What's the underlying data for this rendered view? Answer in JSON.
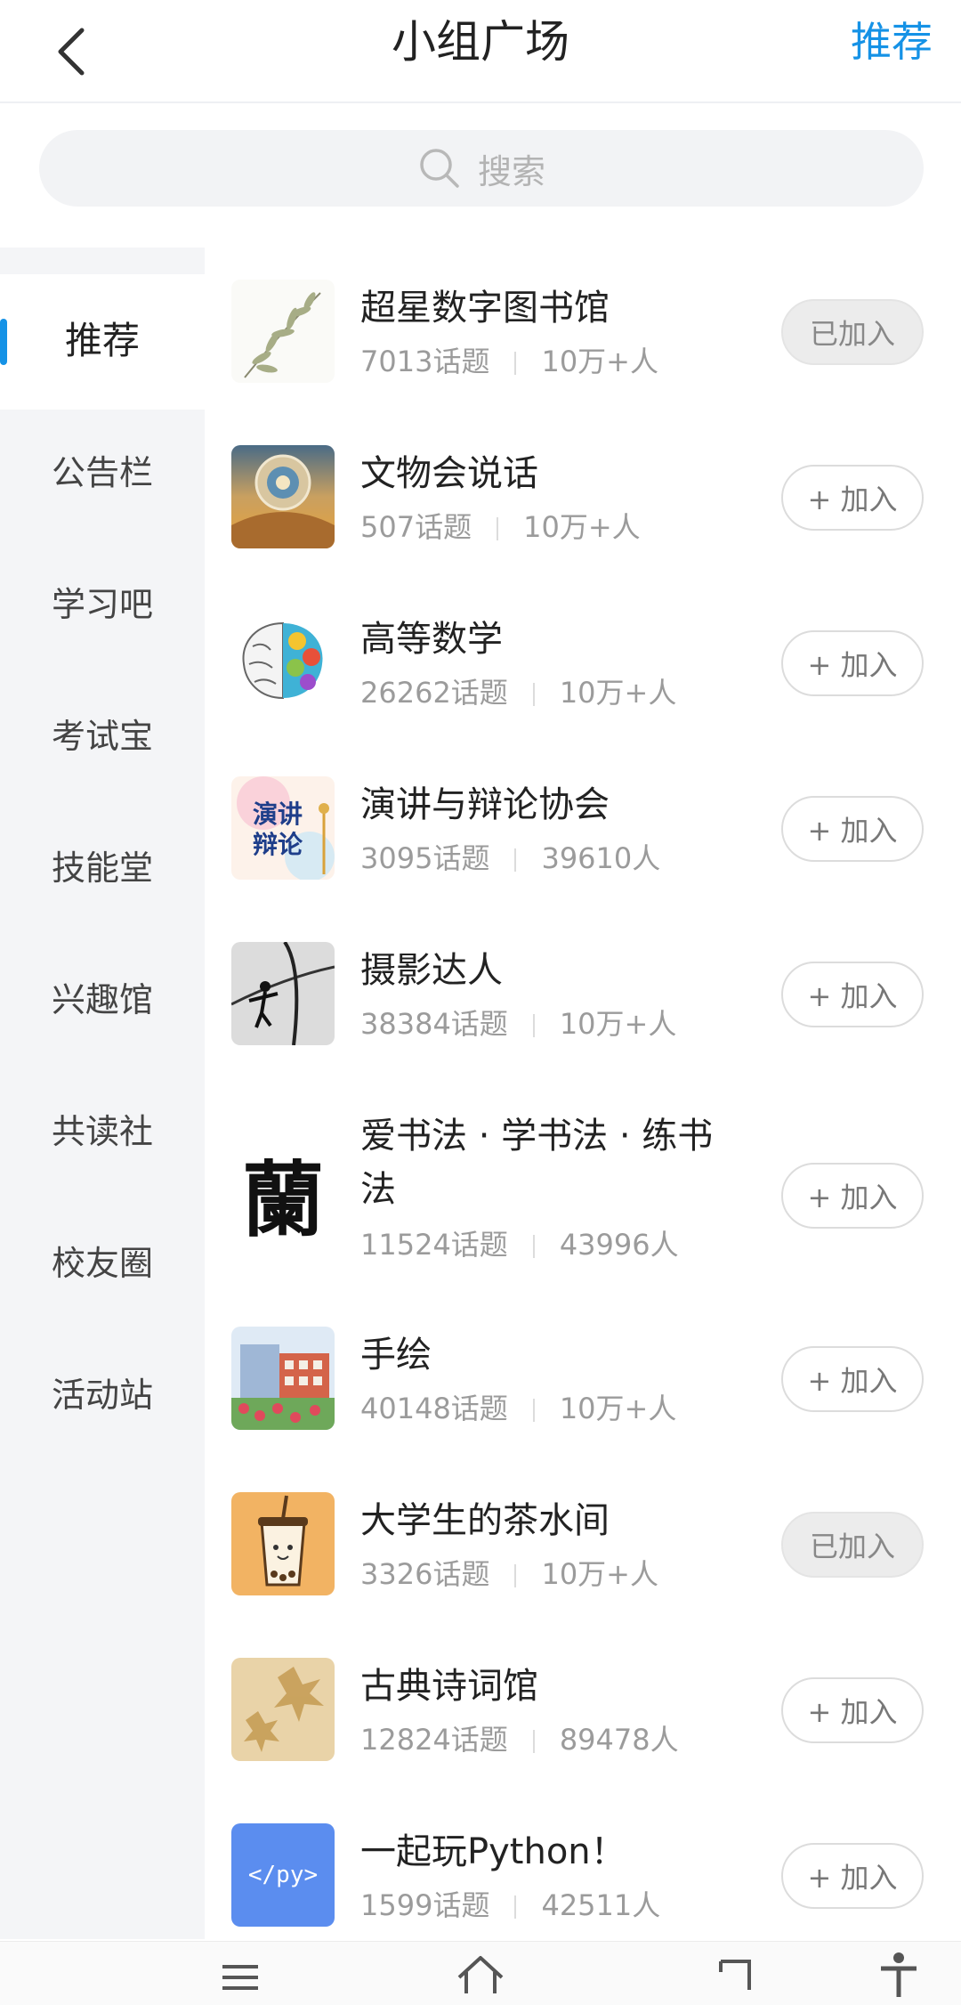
{
  "header": {
    "title": "小组广场",
    "action_label": "推荐"
  },
  "search": {
    "placeholder": "搜索"
  },
  "sidebar": {
    "items": [
      {
        "label": "推荐",
        "active": true
      },
      {
        "label": "公告栏"
      },
      {
        "label": "学习吧"
      },
      {
        "label": "考试宝"
      },
      {
        "label": "技能堂"
      },
      {
        "label": "兴趣馆"
      },
      {
        "label": "共读社"
      },
      {
        "label": "校友圈"
      },
      {
        "label": "活动站"
      }
    ]
  },
  "groups": [
    {
      "name": "超星数字图书馆",
      "topics": "7013话题",
      "members": "10万+人",
      "button": "已加入",
      "joined": true
    },
    {
      "name": "文物会说话",
      "topics": "507话题",
      "members": "10万+人",
      "button": "+ 加入",
      "joined": false
    },
    {
      "name": "高等数学",
      "topics": "26262话题",
      "members": "10万+人",
      "button": "+ 加入",
      "joined": false
    },
    {
      "name": "演讲与辩论协会",
      "topics": "3095话题",
      "members": "39610人",
      "button": "+ 加入",
      "joined": false,
      "thumb_text_1": "演讲",
      "thumb_text_2": "辩论"
    },
    {
      "name": "摄影达人",
      "topics": "38384话题",
      "members": "10万+人",
      "button": "+ 加入",
      "joined": false
    },
    {
      "name": "爱书法 · 学书法 · 练书法",
      "topics": "11524话题",
      "members": "43996人",
      "button": "+ 加入",
      "joined": false,
      "thumb_text": "蘭"
    },
    {
      "name": "手绘",
      "topics": "40148话题",
      "members": "10万+人",
      "button": "+ 加入",
      "joined": false
    },
    {
      "name": "大学生的茶水间",
      "topics": "3326话题",
      "members": "10万+人",
      "button": "已加入",
      "joined": true
    },
    {
      "name": "古典诗词馆",
      "topics": "12824话题",
      "members": "89478人",
      "button": "+ 加入",
      "joined": false
    },
    {
      "name": "一起玩Python！",
      "topics": "1599话题",
      "members": "42511人",
      "button": "+ 加入",
      "joined": false,
      "thumb_text": "</py>"
    }
  ],
  "colors": {
    "accent": "#1592e6",
    "sidebar_bg": "#f4f5f7"
  },
  "bottom_nav": {
    "icons": [
      "menu-icon",
      "home-icon",
      "back-icon",
      "accessibility-icon"
    ]
  }
}
